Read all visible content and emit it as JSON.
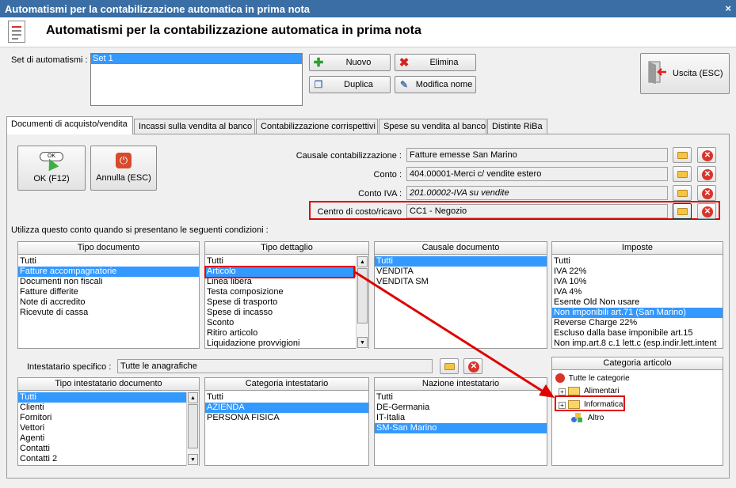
{
  "window": {
    "title": "Automatismi per la contabilizzazione automatica in prima nota",
    "close": "×"
  },
  "header": {
    "title": "Automatismi per la contabilizzazione automatica in prima nota"
  },
  "set": {
    "label": "Set di automatismi :",
    "items": [
      "Set 1"
    ],
    "selected": 0
  },
  "toolbar": {
    "nuovo": "Nuovo",
    "elimina": "Elimina",
    "duplica": "Duplica",
    "modifica": "Modifica nome",
    "uscita": "Uscita (ESC)"
  },
  "tabs": [
    "Documenti di acquisto/vendita",
    "Incassi sulla vendita al banco",
    "Contabilizzazione corrispettivi",
    "Spese su vendita al banco",
    "Distinte RiBa"
  ],
  "actions": {
    "ok": "OK (F12)",
    "ok_icon_text": "OK",
    "annulla": "Annulla (ESC)"
  },
  "fields": {
    "causale_label": "Causale contabilizzazione :",
    "causale_value": "Fatture emesse San Marino",
    "conto_label": "Conto :",
    "conto_value": "404.00001-Merci c/ vendite estero",
    "contoiva_label": "Conto IVA :",
    "contoiva_value": "201.00002-IVA su vendite",
    "centro_label": "Centro di costo/ricavo",
    "centro_value": "CC1 - Negozio"
  },
  "conditions_label": "Utilizza questo conto quando si presentano le seguenti condizioni :",
  "tipo_documento": {
    "header": "Tipo documento",
    "items": [
      "Tutti",
      "Fatture accompagnatorie",
      "Documenti non fiscali",
      "Fatture differite",
      "Note di accredito",
      "Ricevute di cassa"
    ],
    "selected": 1
  },
  "tipo_dettaglio": {
    "header": "Tipo dettaglio",
    "items": [
      "Tutti",
      "Articolo",
      "Linea libera",
      "Testa composizione",
      "Spese di trasporto",
      "Spese di incasso",
      "Sconto",
      "Ritiro articolo",
      "Liquidazione provvigioni"
    ],
    "selected": 1
  },
  "causale_documento": {
    "header": "Causale documento",
    "items": [
      "Tutti",
      "VENDITA",
      "VENDITA SM"
    ],
    "selected": 0
  },
  "imposte": {
    "header": "Imposte",
    "items": [
      "Tutti",
      "IVA 22%",
      "IVA 10%",
      "IVA 4%",
      "Esente Old Non usare",
      "Non imponibili art.71 (San Marino)",
      "Reverse Charge 22%",
      "Escluso dalla base imponibile art.15",
      "Non imp.art.8 c.1 lett.c (esp.indir.lett.intent"
    ],
    "selected": 5
  },
  "intestatario": {
    "label": "Intestatario specifico :",
    "value": "Tutte le anagrafiche"
  },
  "tipo_intestatario": {
    "header": "Tipo intestatario documento",
    "items": [
      "Tutti",
      "Clienti",
      "Fornitori",
      "Vettori",
      "Agenti",
      "Contatti",
      "Contatti 2"
    ],
    "selected": 0
  },
  "categoria_intestatario": {
    "header": "Categoria intestatario",
    "items": [
      "Tutti",
      "AZIENDA",
      "PERSONA FISICA"
    ],
    "selected": 1
  },
  "nazione_intestatario": {
    "header": "Nazione intestatario",
    "items": [
      "Tutti",
      "DE-Germania",
      "IT-Italia",
      "SM-San Marino"
    ],
    "selected": 3
  },
  "categoria_articolo": {
    "header": "Categoria articolo",
    "root": "Tutte le categorie",
    "children": [
      "Alimentari",
      "Informatica",
      "Altro"
    ]
  },
  "colors": {
    "selection": "#3399ff",
    "highlight": "#e00000",
    "titlebar": "#3a6ea5"
  }
}
